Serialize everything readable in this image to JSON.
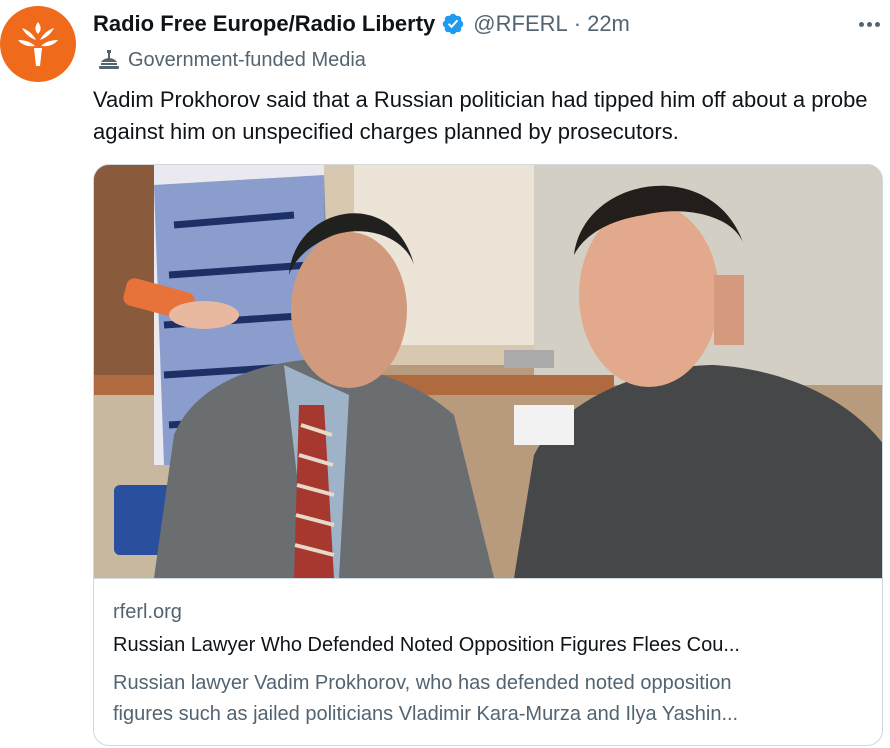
{
  "author": {
    "display_name": "Radio Free Europe/Radio Liberty",
    "handle": "@RFERL",
    "separator": "·",
    "time": "22m",
    "verified_icon": "verified-badge-icon",
    "avatar_icon": "rferl-torch-logo"
  },
  "label": {
    "text": "Government-funded Media",
    "icon": "government-building-icon"
  },
  "tweet": {
    "text": "Vadim Prokhorov said that a Russian politician had tipped him off about a probe against him on unspecified charges planned by prosecutors."
  },
  "card": {
    "domain": "rferl.org",
    "title": "Russian Lawyer Who Defended Noted Opposition Figures Flees Cou...",
    "description_line1": "Russian lawyer Vadim Prokhorov, who has defended noted opposition",
    "description_line2": "figures such as jailed politicians Vladimir Kara-Murza and Ilya Yashin..."
  },
  "colors": {
    "brand_orange": "#f06a1c",
    "verified_blue": "#1d9bf0",
    "secondary_text": "#536471",
    "primary_text": "#0f1419",
    "border": "#cfd9de"
  }
}
